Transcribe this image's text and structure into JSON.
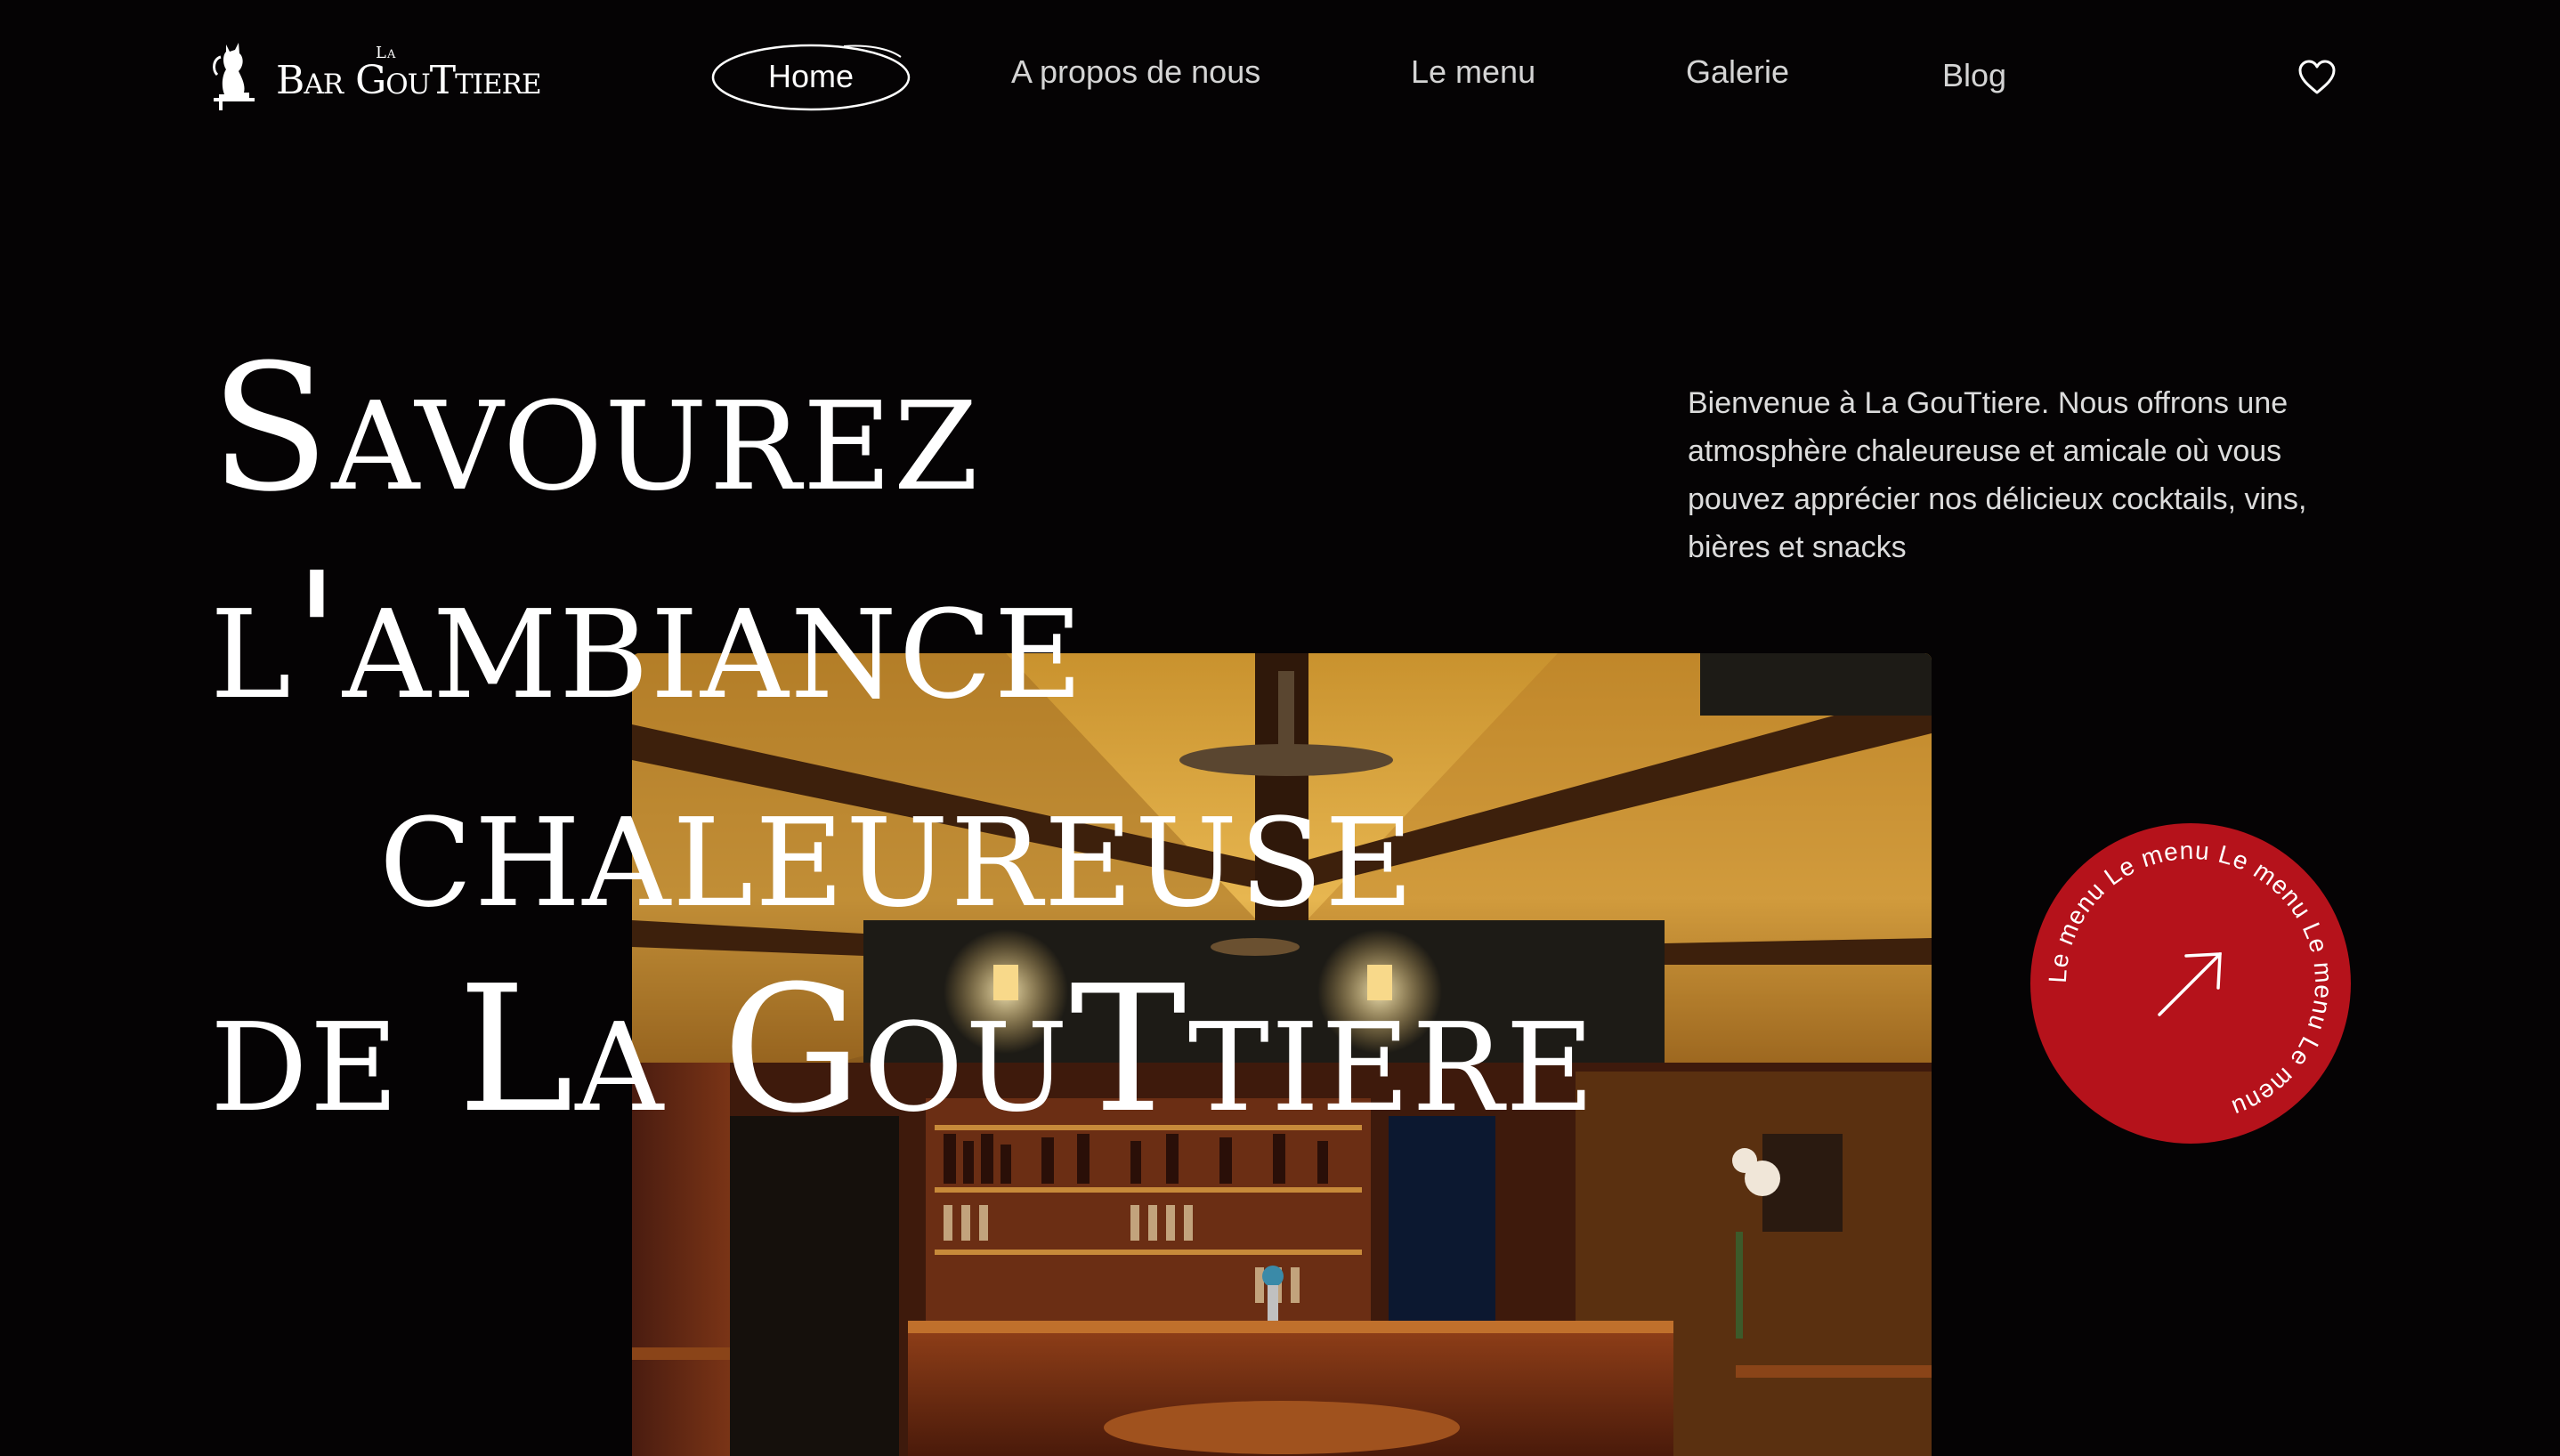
{
  "brand": {
    "logo_word_1": "Bar",
    "logo_small": "La",
    "logo_word_2": "GouTtiere"
  },
  "nav": {
    "home": "Home",
    "about": "A propos de nous",
    "menu": "Le menu",
    "gallery": "Galerie",
    "blog": "Blog",
    "favorites_icon": "heart-icon"
  },
  "hero": {
    "line1": "Savourez",
    "line2": "l'ambiance",
    "line3": "chaleureuse",
    "line4": "de La GouTtiere",
    "intro": "Bienvenue à La GouTtiere. Nous offrons une atmosphère chaleureuse et amicale où vous pouvez apprécier nos délicieux cocktails, vins, bières et snacks",
    "photo_name": "bar-interior-photo"
  },
  "badge": {
    "ring_text": "Le menu  Le menu  Le menu  Le menu  Le menu  ",
    "icon": "arrow-up-right-icon",
    "color": "#b5121b"
  },
  "colors": {
    "background": "#050304",
    "accent": "#b5121b"
  }
}
